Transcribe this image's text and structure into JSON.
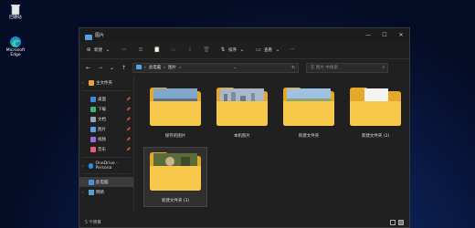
{
  "desktop": {
    "recycle_label": "回收站",
    "edge_label": "Microsoft Edge"
  },
  "window": {
    "title": "图片",
    "controls": [
      "—",
      "☐",
      "✕"
    ]
  },
  "toolbar": {
    "new_label": "新建",
    "sort_label": "排序",
    "view_label": "查看",
    "more_label": "···"
  },
  "address": {
    "path": [
      "此电脑",
      "图片"
    ],
    "search_placeholder": "在 图片 中搜索"
  },
  "nav": {
    "home": "主文件夹",
    "quick": [
      {
        "label": "桌面",
        "color": "#3d8bd8"
      },
      {
        "label": "下载",
        "color": "#3cb371"
      },
      {
        "label": "文档",
        "color": "#9aa4b2"
      },
      {
        "label": "图片",
        "color": "#5aa0e6"
      },
      {
        "label": "视频",
        "color": "#a06ad6"
      },
      {
        "label": "音乐",
        "color": "#e85d75"
      }
    ],
    "onedrive": "OneDrive - Persona",
    "thispc": "此电脑",
    "network": "网络"
  },
  "files": [
    {
      "name": "保存的图片",
      "preview": "sky"
    },
    {
      "name": "本机照片",
      "preview": "city"
    },
    {
      "name": "新建文件夹",
      "preview": "field"
    },
    {
      "name": "新建文件夹 (2)",
      "preview": "doc"
    },
    {
      "name": "新建文件夹 (3)",
      "preview": "forest"
    }
  ],
  "status": {
    "count": "5 个项目"
  },
  "colors": {
    "folder": "#f7c84a",
    "folder_back": "#e4a82b"
  }
}
